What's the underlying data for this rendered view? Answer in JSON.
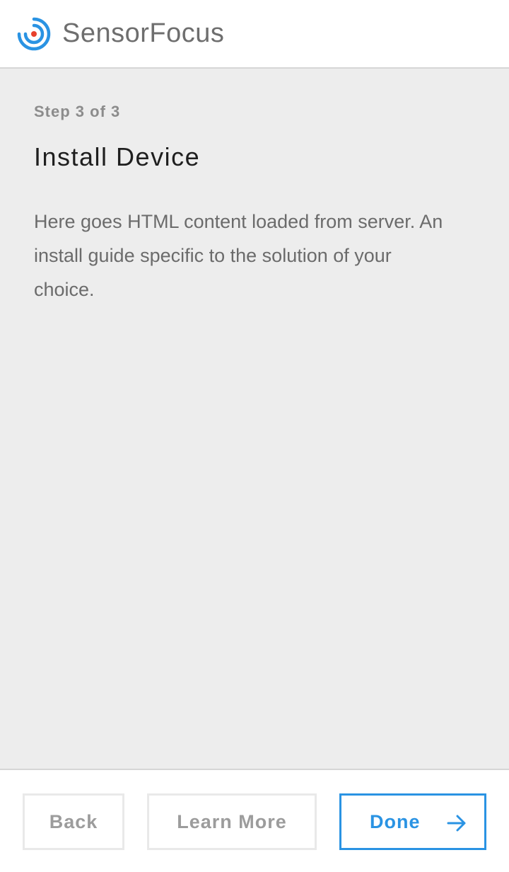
{
  "header": {
    "app_name": "SensorFocus",
    "logo_icon": "sensorfocus-logo-icon"
  },
  "colors": {
    "accent": "#2a93e3",
    "logo_dot": "#e8412c",
    "content_bg": "#ededed"
  },
  "content": {
    "step_label": "Step 3 of 3",
    "title": "Install Device",
    "body": "Here goes HTML content loaded from server. An install guide specific to the solution of your choice."
  },
  "footer": {
    "back_label": "Back",
    "learn_more_label": "Learn More",
    "done_label": "Done",
    "done_icon": "arrow-right-icon"
  }
}
